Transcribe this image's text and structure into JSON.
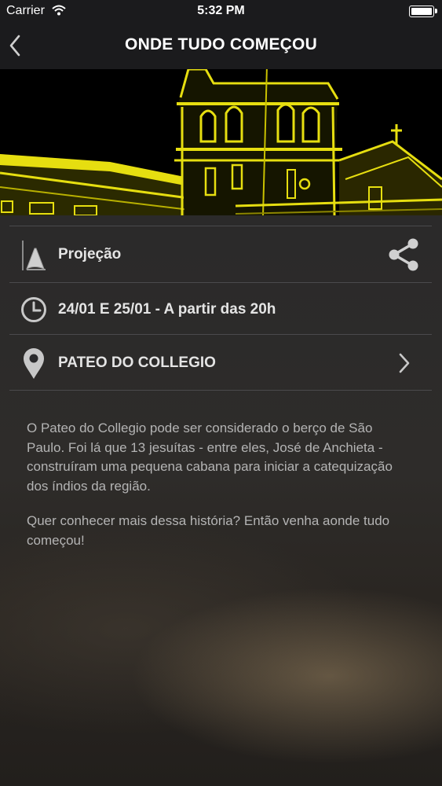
{
  "status": {
    "carrier": "Carrier",
    "time": "5:32 PM"
  },
  "nav": {
    "title": "ONDE TUDO COMEÇOU"
  },
  "details": {
    "category": "Projeção",
    "schedule": "24/01 E 25/01 - A partir das 20h",
    "location": "PATEO DO COLLEGIO"
  },
  "description": {
    "paragraph1": "O Pateo do Collegio pode ser considerado o berço de São Paulo. Foi lá que 13 jesuítas - entre eles, José de Anchieta - construíram uma pequena cabana para iniciar a catequização dos índios da região.",
    "paragraph2": "Quer conhecer mais dessa história? Então venha aonde tudo começou!"
  },
  "icons": {
    "wifi": "wifi-icon",
    "battery": "battery-icon",
    "back": "chevron-left-icon",
    "projector": "projector-icon",
    "share": "share-icon",
    "clock": "clock-icon",
    "pin": "map-pin-icon",
    "chevron": "chevron-right-icon"
  },
  "colors": {
    "accent": "#e8e000",
    "background": "#2a2a2c",
    "bar": "#1b1b1d"
  }
}
